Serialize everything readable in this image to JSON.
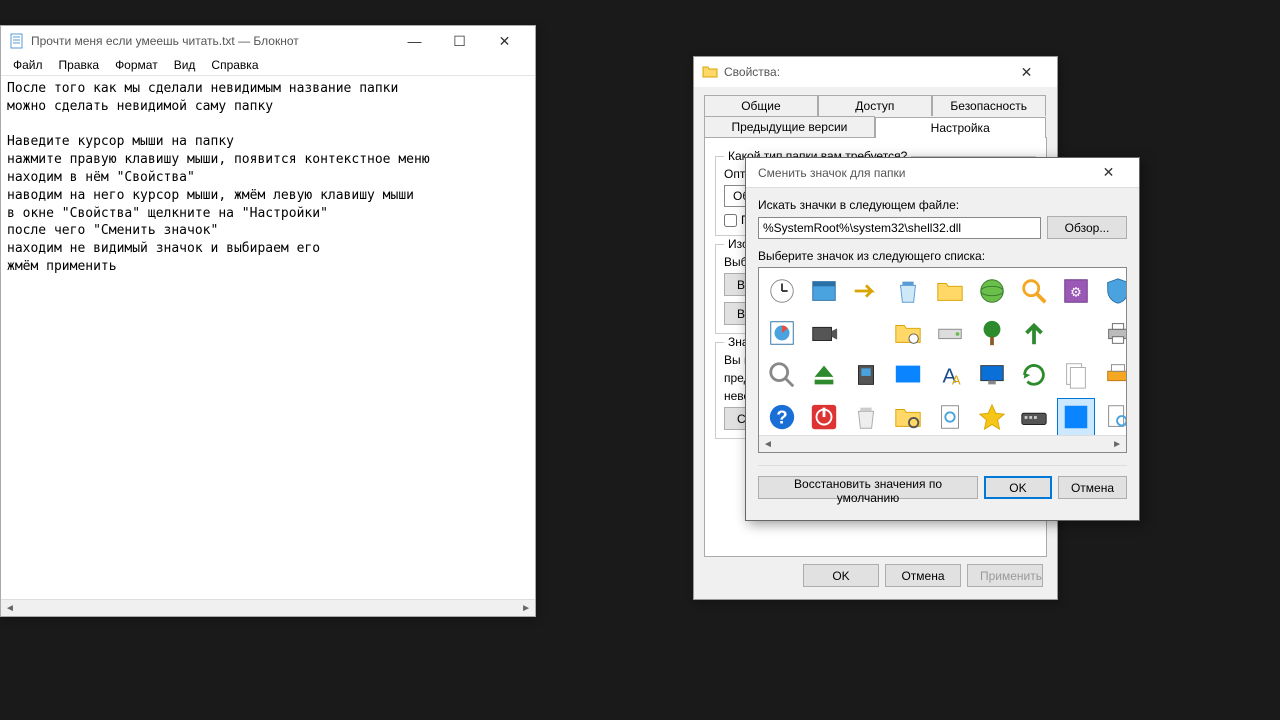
{
  "notepad": {
    "title": "Прочти меня если умеешь читать.txt — Блокнот",
    "menu": {
      "file": "Файл",
      "edit": "Правка",
      "format": "Формат",
      "view": "Вид",
      "help": "Справка"
    },
    "content": "После того как мы сделали невидимым название папки\nможно сделать невидимой саму папку\n\nНаведите курсор мыши на папку\nнажмите правую клавишу мыши, появится контекстное меню\nнаходим в нём \"Свойства\"\nнаводим на него курсор мыши, жмём левую клавишу мыши\nв окне \"Свойства\" щелкните на \"Настройки\"\nпосле чего \"Сменить значок\"\nнаходим не видимый значок и выбираем его\nжмём применить"
  },
  "props": {
    "title": "Свойства:",
    "tabs": {
      "general": "Общие",
      "access": "Доступ",
      "security": "Безопасность",
      "prev": "Предыдущие версии",
      "custom": "Настройка"
    },
    "q_type": "Какой тип папки вам требуется?",
    "optimize": "Оптимизировать эту папку:",
    "general_sel": "Общие элементы",
    "apply_sub": "Применять этот же шаблон ко всем подпапкам",
    "images": "Изображения папок",
    "choose_file": "Выберите файл, отображающий эту папку.",
    "restore": "Восстановить умолчания",
    "icons": "Значки папок",
    "icons_desc1": "Вы можете изменить значок папки. Эти изменения не",
    "icons_desc2": "предварительно просматриваются вместе с ними.",
    "icons_desc3": "невозможно",
    "change_icon": "Сменить значок...",
    "ok": "OK",
    "cancel": "Отмена",
    "apply": "Применить"
  },
  "icondlg": {
    "title": "Сменить значок для папки",
    "search_lbl": "Искать значки в следующем файле:",
    "path": "%SystemRoot%\\system32\\shell32.dll",
    "browse": "Обзор...",
    "pick_lbl": "Выберите значок из следующего списка:",
    "restore": "Восстановить значения по умолчанию",
    "ok": "OK",
    "cancel": "Отмена"
  }
}
